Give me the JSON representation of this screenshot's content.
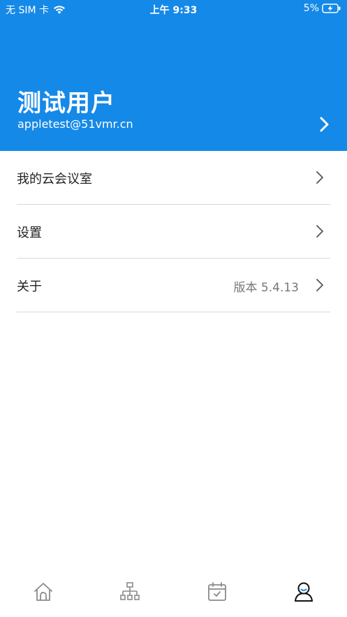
{
  "status_bar": {
    "carrier": "无 SIM 卡",
    "time": "上午 9:33",
    "battery": "5%"
  },
  "profile": {
    "name": "测试用户",
    "email": "appletest@51vmr.cn"
  },
  "menu": {
    "items": [
      {
        "label": "我的云会议室",
        "value": ""
      },
      {
        "label": "设置",
        "value": ""
      },
      {
        "label": "关于",
        "value": "版本 5.4.13"
      }
    ]
  },
  "tabs": [
    {
      "icon": "home-icon"
    },
    {
      "icon": "org-chart-icon"
    },
    {
      "icon": "calendar-icon"
    },
    {
      "icon": "user-icon",
      "active": true
    }
  ],
  "colors": {
    "header": "#1589e8",
    "active_tab_accent": "#1589e8",
    "inactive_tab": "#8a8a8a",
    "divider": "#d8d8d8"
  }
}
